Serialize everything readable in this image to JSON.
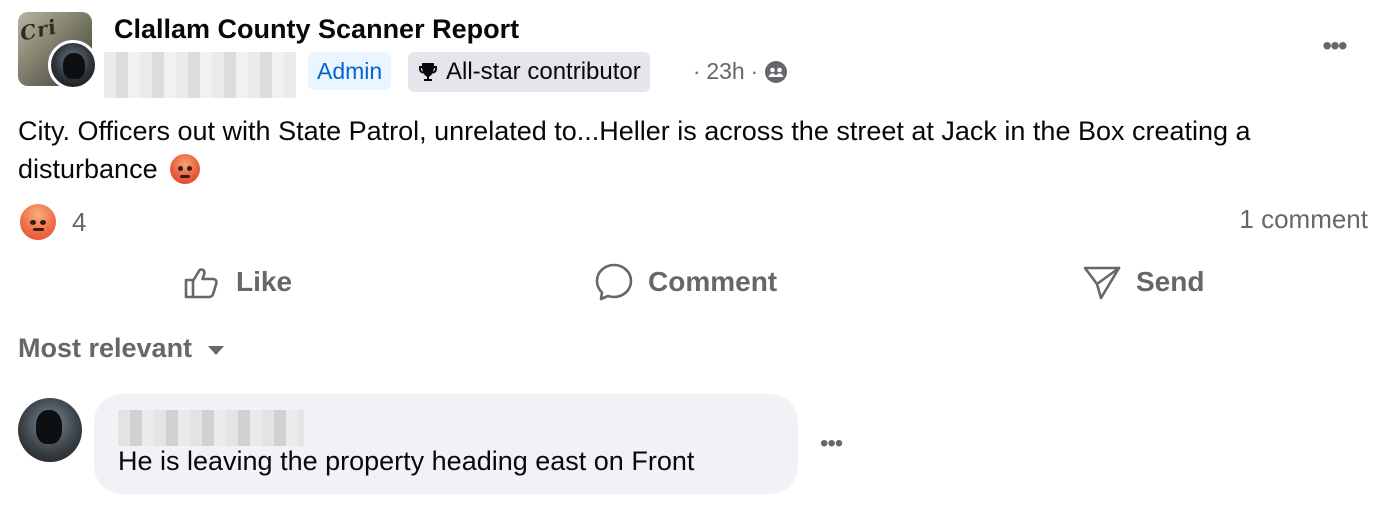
{
  "post": {
    "group_name": "Clallam County Scanner Report",
    "badges": {
      "admin": "Admin",
      "contributor": "All-star contributor"
    },
    "time": "23h",
    "separator": "·",
    "audience_icon": "group-audience-icon",
    "text": "City. Officers out with State Patrol, unrelated to...Heller is across the street at Jack in the Box creating a disturbance",
    "inline_emoji": "angry-face-emoji"
  },
  "reactions": {
    "type": "angry",
    "count": "4",
    "comments_label": "1 comment"
  },
  "actions": {
    "like": "Like",
    "comment": "Comment",
    "send": "Send"
  },
  "comments": {
    "sort_label": "Most relevant",
    "items": [
      {
        "text": "He is leaving the property heading east on Front"
      }
    ]
  },
  "colors": {
    "secondary_text": "#65676b",
    "admin_badge_bg": "#ebf5ff",
    "admin_badge_text": "#0064d1",
    "bubble_bg": "#f0f2f5"
  }
}
